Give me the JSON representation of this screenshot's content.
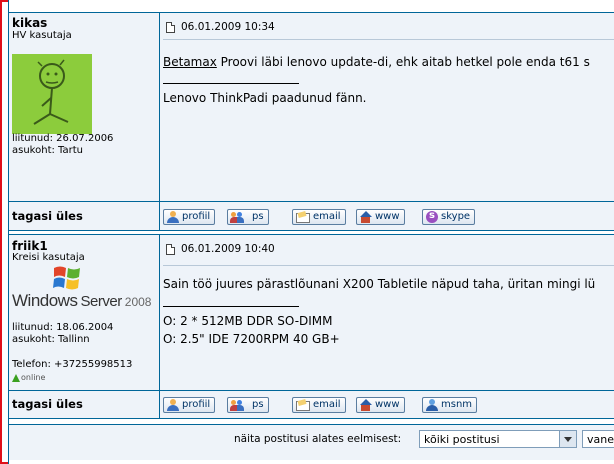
{
  "posts": [
    {
      "username": "kikas",
      "rank": "HV kasutaja",
      "joined": "liitunud: 26.07.2006",
      "location": "asukoht: Tartu",
      "date": "06.01.2009 10:34",
      "quote_name": "Betamax",
      "body": " Proovi läbi lenovo update-di, ehk aitab hetkel pole enda t61 s",
      "signature": "Lenovo ThinkPadi paadunud fänn.",
      "back_to_top": "tagasi üles",
      "buttons": [
        "profiil",
        "ps",
        "email",
        "www",
        "skype"
      ]
    },
    {
      "username": "friik1",
      "rank": "Kreisi kasutaja",
      "avatar_text": "Windows Server 2008",
      "avatar_brand": "Windows",
      "avatar_product": "Server",
      "avatar_year": "2008",
      "joined": "liitunud: 18.06.2004",
      "location": "asukoht: Tallinn",
      "phone": "Telefon: +37255998513",
      "status": "online",
      "date": "06.01.2009 10:40",
      "body": "Sain töö juures pärastlõunani X200 Tabletile näpud taha, üritan mingi lü",
      "sig_lines": [
        "O: 2 * 512MB DDR SO-DIMM",
        "O: 2.5\" IDE 7200RPM 40 GB+"
      ],
      "back_to_top": "tagasi üles",
      "buttons": [
        "profiil",
        "ps",
        "email",
        "www",
        "msnm"
      ]
    }
  ],
  "footer": {
    "label": "näita postitusi alates eelmisest:",
    "select_value": "kõiki postitusi",
    "order_value": "vane"
  },
  "colors": {
    "border": "#006699",
    "cell_bg": "#eef3f9",
    "frame": "#e0101a"
  }
}
